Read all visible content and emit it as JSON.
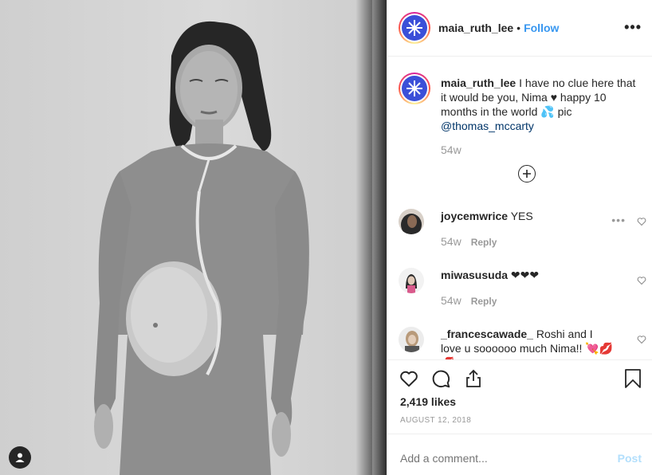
{
  "post": {
    "username": "maia_ruth_lee",
    "separator": "•",
    "follow_label": "Follow",
    "more_label": "•••"
  },
  "caption": {
    "username": "maia_ruth_lee",
    "text": "I have no clue here that it would be you, Nima ♥ happy 10 months in the world 💦 pic",
    "mention": "@thomas_mccarty",
    "time": "54w"
  },
  "comments": [
    {
      "username": "joycemwrice",
      "text": "YES",
      "time": "54w",
      "reply_label": "Reply"
    },
    {
      "username": "miwasusuda",
      "text": "❤❤❤",
      "time": "54w",
      "reply_label": "Reply"
    },
    {
      "username": "_francescawade_",
      "text": "Roshi and I love u soooooo much Nima!! 💘💋💋"
    }
  ],
  "likes": "2,419 likes",
  "date": "AUGUST 12, 2018",
  "add_comment": {
    "placeholder": "Add a comment...",
    "post_label": "Post"
  },
  "icons": {
    "user_tag": "user-tag-icon",
    "like": "heart-icon",
    "comment": "comment-icon",
    "share": "share-icon",
    "save": "bookmark-icon",
    "load_more": "plus-circle-icon"
  },
  "colors": {
    "link": "#3897f0",
    "mention": "#003569",
    "post_disabled": "#b2dffc",
    "muted": "#999999"
  }
}
